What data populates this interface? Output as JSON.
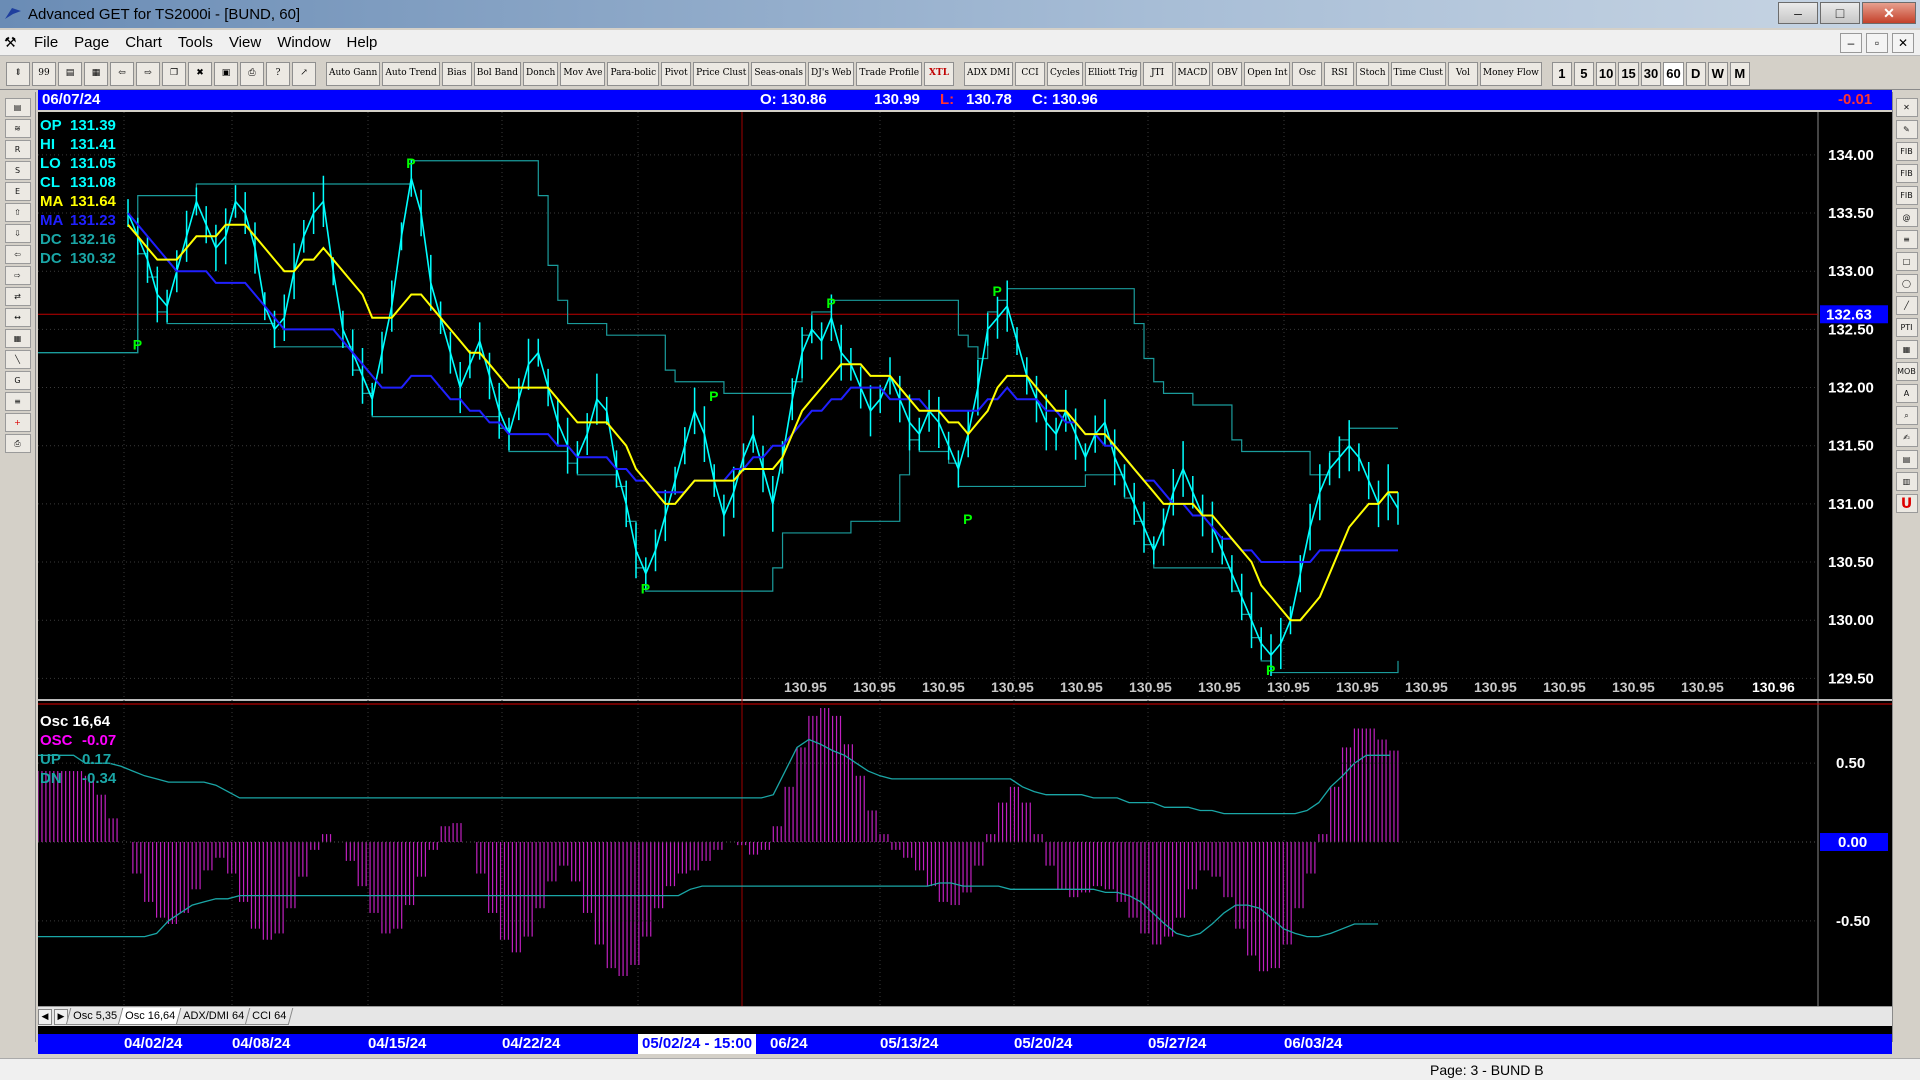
{
  "window": {
    "title": "Advanced GET for TS2000i - [BUND, 60]",
    "minimize": "‒",
    "maximize": "□",
    "close": "✕"
  },
  "menu": [
    "File",
    "Page",
    "Chart",
    "Tools",
    "View",
    "Window",
    "Help"
  ],
  "mdi": {
    "min": "‒",
    "restore": "▫",
    "close": "✕"
  },
  "toolbar": {
    "studies": [
      "Auto Gann",
      "Auto Trend",
      "Bias",
      "Bol Band",
      "Donch",
      "Mov Ave",
      "Para-bolic",
      "Pivot",
      "Price Clust",
      "Seas-onals",
      "DJ's Web",
      "Trade Profile",
      "XTL",
      "ADX DMI",
      "CCI",
      "Cycles",
      "Elliott Trig",
      "JTI",
      "MACD",
      "OBV",
      "Open Int",
      "Osc",
      "RSI",
      "Stoch",
      "Time Clust",
      "Vol",
      "Money Flow"
    ],
    "periods": [
      "1",
      "5",
      "10",
      "15",
      "30",
      "60",
      "D",
      "W",
      "M"
    ],
    "active_period": "60"
  },
  "left_tools": [
    "open",
    "zig",
    "reset",
    "study",
    "elliott",
    "up",
    "down",
    "left",
    "right",
    "expand",
    "zoom",
    "grid",
    "lines",
    "gann",
    "fib",
    "cross",
    "print"
  ],
  "right_tools": [
    "X",
    "pen",
    "fib-ret",
    "fib-ext",
    "fib-time",
    "spiral",
    "fan",
    "box",
    "ellipse",
    "regress",
    "PTI",
    "grid",
    "MOB",
    "A",
    "zoom",
    "paint",
    "layout",
    "table",
    "U"
  ],
  "infobar": {
    "date": "06/07/24",
    "open": "O: 130.86",
    "high": "130.99",
    "low_label": "L:",
    "low": "130.78",
    "close": "C: 130.96",
    "change": "-0.01"
  },
  "price_legend": [
    {
      "label": "OP",
      "value": "131.39",
      "color": "#00ffff"
    },
    {
      "label": "HI",
      "value": "131.41",
      "color": "#00ffff"
    },
    {
      "label": "LO",
      "value": "131.05",
      "color": "#00ffff"
    },
    {
      "label": "CL",
      "value": "131.08",
      "color": "#00ffff"
    },
    {
      "label": "MA",
      "value": "131.64",
      "color": "#ffff00"
    },
    {
      "label": "MA",
      "value": "131.23",
      "color": "#2020ff"
    },
    {
      "label": "DC",
      "value": "132.16",
      "color": "#1aa6a6"
    },
    {
      "label": "DC",
      "value": "130.32",
      "color": "#1aa6a6"
    }
  ],
  "osc_legend": [
    {
      "label": "Osc 16,64",
      "value": "",
      "color": "#ffffff"
    },
    {
      "label": "OSC",
      "value": "-0.07",
      "color": "#ff00ff"
    },
    {
      "label": "UP",
      "value": "0.17",
      "color": "#1aa6a6"
    },
    {
      "label": "DN",
      "value": "-0.34",
      "color": "#1aa6a6"
    }
  ],
  "price_axis": [
    "134.00",
    "133.50",
    "133.00",
    "132.50",
    "132.00",
    "131.50",
    "131.00",
    "130.50",
    "130.00",
    "129.50"
  ],
  "hline_label": "132.63",
  "osc_axis": [
    "0.50",
    "0.00",
    "-0.50"
  ],
  "osc_zero_label": "0.00",
  "bottom_strip": [
    "130.95",
    "130.95",
    "130.95",
    "130.95",
    "130.95",
    "130.95",
    "130.95",
    "130.95",
    "130.95",
    "130.95",
    "130.95",
    "130.95",
    "130.95",
    "130.95"
  ],
  "last_price": "130.96",
  "pivot_label": "P",
  "tabs": [
    "Osc 5,35",
    "Osc 16,64",
    "ADX/DMI 64",
    "CCI 64"
  ],
  "active_tab": "Osc 16,64",
  "dates": [
    "04/02/24",
    "04/08/24",
    "04/15/24",
    "04/22/24",
    "06/24",
    "05/13/24",
    "05/20/24",
    "05/27/24",
    "06/03/24"
  ],
  "cursor_date": "05/02/24 - 15:00",
  "status": "Page: 3 - BUND B",
  "chart_data": {
    "type": "line",
    "symbol": "BUND",
    "interval": "60",
    "ylim": [
      129.4,
      134.3
    ],
    "osc_ylim": [
      -0.85,
      0.85
    ],
    "x_range": [
      0,
      230
    ],
    "horizontal_line": 132.63,
    "vertical_cursor_x": 97,
    "price": [
      133.5,
      133.3,
      133.1,
      132.8,
      132.7,
      133.0,
      133.3,
      133.6,
      133.4,
      133.2,
      133.3,
      133.6,
      133.5,
      133.2,
      132.7,
      132.5,
      132.6,
      133.0,
      133.3,
      133.5,
      133.6,
      133.0,
      132.5,
      132.3,
      132.1,
      131.9,
      132.3,
      132.7,
      133.3,
      133.8,
      133.5,
      132.9,
      132.6,
      132.3,
      132.0,
      132.2,
      132.4,
      132.1,
      131.8,
      131.6,
      131.9,
      132.2,
      132.3,
      132.0,
      131.7,
      131.5,
      131.4,
      131.6,
      131.9,
      131.8,
      131.3,
      131.0,
      130.6,
      130.4,
      130.6,
      130.9,
      131.2,
      131.5,
      131.8,
      131.6,
      131.2,
      130.9,
      131.1,
      131.4,
      131.6,
      131.3,
      131.0,
      131.4,
      131.9,
      132.3,
      132.5,
      132.4,
      132.6,
      132.3,
      132.2,
      132.0,
      131.8,
      131.9,
      132.1,
      131.9,
      131.7,
      131.6,
      131.8,
      131.7,
      131.5,
      131.3,
      131.6,
      132.0,
      132.5,
      132.6,
      132.7,
      132.4,
      132.1,
      131.9,
      131.7,
      131.6,
      131.8,
      131.6,
      131.4,
      131.6,
      131.7,
      131.4,
      131.2,
      131.0,
      130.8,
      130.6,
      130.8,
      131.1,
      131.3,
      131.1,
      130.9,
      130.8,
      130.6,
      130.4,
      130.2,
      130.0,
      129.8,
      129.7,
      129.8,
      130.0,
      130.4,
      130.8,
      131.1,
      131.3,
      131.4,
      131.5,
      131.4,
      131.2,
      131.0,
      131.1,
      130.96
    ],
    "ma_fast": [
      133.4,
      133.3,
      133.2,
      133.1,
      133.1,
      133.1,
      133.2,
      133.3,
      133.3,
      133.3,
      133.4,
      133.4,
      133.4,
      133.3,
      133.2,
      133.1,
      133.0,
      133.0,
      133.1,
      133.1,
      133.2,
      133.1,
      133.0,
      132.9,
      132.8,
      132.6,
      132.6,
      132.6,
      132.7,
      132.8,
      132.8,
      132.7,
      132.6,
      132.5,
      132.4,
      132.3,
      132.3,
      132.2,
      132.1,
      132.0,
      132.0,
      132.0,
      132.0,
      132.0,
      131.9,
      131.8,
      131.7,
      131.7,
      131.7,
      131.7,
      131.6,
      131.5,
      131.3,
      131.2,
      131.1,
      131.0,
      131.0,
      131.1,
      131.2,
      131.2,
      131.2,
      131.2,
      131.2,
      131.3,
      131.3,
      131.3,
      131.3,
      131.4,
      131.6,
      131.8,
      131.9,
      132.0,
      132.1,
      132.2,
      132.2,
      132.2,
      132.1,
      132.1,
      132.1,
      132.0,
      131.9,
      131.8,
      131.8,
      131.8,
      131.7,
      131.7,
      131.6,
      131.7,
      131.8,
      132.0,
      132.1,
      132.1,
      132.1,
      132.0,
      131.9,
      131.8,
      131.8,
      131.7,
      131.6,
      131.6,
      131.6,
      131.5,
      131.4,
      131.3,
      131.2,
      131.1,
      131.0,
      131.0,
      131.0,
      131.0,
      130.9,
      130.9,
      130.8,
      130.7,
      130.6,
      130.5,
      130.3,
      130.2,
      130.1,
      130.0,
      130.0,
      130.1,
      130.2,
      130.4,
      130.6,
      130.8,
      130.9,
      131.0,
      131.0,
      131.1,
      131.1
    ],
    "ma_slow": [
      133.5,
      133.4,
      133.3,
      133.2,
      133.1,
      133.0,
      133.0,
      133.0,
      133.0,
      132.9,
      132.9,
      132.9,
      132.9,
      132.8,
      132.7,
      132.6,
      132.5,
      132.5,
      132.5,
      132.5,
      132.5,
      132.5,
      132.4,
      132.3,
      132.2,
      132.1,
      132.0,
      132.0,
      132.0,
      132.1,
      132.1,
      132.1,
      132.0,
      131.9,
      131.9,
      131.8,
      131.8,
      131.7,
      131.7,
      131.6,
      131.6,
      131.6,
      131.6,
      131.6,
      131.5,
      131.5,
      131.4,
      131.4,
      131.4,
      131.4,
      131.3,
      131.3,
      131.2,
      131.2,
      131.1,
      131.1,
      131.1,
      131.1,
      131.2,
      131.2,
      131.2,
      131.2,
      131.3,
      131.3,
      131.4,
      131.4,
      131.5,
      131.5,
      131.6,
      131.7,
      131.8,
      131.8,
      131.9,
      131.9,
      132.0,
      132.0,
      132.0,
      132.0,
      131.9,
      131.9,
      131.9,
      131.9,
      131.8,
      131.8,
      131.8,
      131.8,
      131.8,
      131.8,
      131.9,
      131.9,
      132.0,
      131.9,
      131.9,
      131.9,
      131.8,
      131.8,
      131.7,
      131.7,
      131.6,
      131.6,
      131.5,
      131.5,
      131.4,
      131.3,
      131.2,
      131.2,
      131.1,
      131.0,
      131.0,
      130.9,
      130.9,
      130.8,
      130.7,
      130.7,
      130.6,
      130.6,
      130.5,
      130.5,
      130.5,
      130.5,
      130.5,
      130.5,
      130.6,
      130.6,
      130.6,
      130.6,
      130.6,
      130.6,
      130.6,
      130.6,
      130.6
    ],
    "pivots": [
      {
        "x": 1,
        "y": 132.5,
        "pos": "low"
      },
      {
        "x": 29,
        "y": 133.8,
        "pos": "high"
      },
      {
        "x": 53,
        "y": 130.4,
        "pos": "low"
      },
      {
        "x": 60,
        "y": 131.8,
        "pos": "high"
      },
      {
        "x": 72,
        "y": 132.6,
        "pos": "high"
      },
      {
        "x": 86,
        "y": 131.0,
        "pos": "low"
      },
      {
        "x": 89,
        "y": 132.7,
        "pos": "high"
      },
      {
        "x": 117,
        "y": 129.7,
        "pos": "low"
      }
    ],
    "oscillator": [
      0.45,
      0.45,
      0.45,
      0.45,
      0.42,
      0.3,
      0.15,
      0.0,
      -0.2,
      -0.38,
      -0.48,
      -0.52,
      -0.45,
      -0.3,
      -0.18,
      -0.1,
      -0.2,
      -0.38,
      -0.55,
      -0.62,
      -0.58,
      -0.42,
      -0.22,
      -0.05,
      0.05,
      0.0,
      -0.12,
      -0.28,
      -0.45,
      -0.58,
      -0.55,
      -0.4,
      -0.22,
      -0.05,
      0.1,
      0.12,
      0.0,
      -0.2,
      -0.45,
      -0.62,
      -0.7,
      -0.6,
      -0.42,
      -0.25,
      -0.15,
      -0.25,
      -0.45,
      -0.65,
      -0.8,
      -0.85,
      -0.78,
      -0.6,
      -0.42,
      -0.28,
      -0.2,
      -0.18,
      -0.12,
      -0.05,
      0.0,
      -0.02,
      -0.08,
      -0.05,
      0.1,
      0.35,
      0.6,
      0.8,
      0.85,
      0.8,
      0.62,
      0.42,
      0.2,
      0.05,
      -0.05,
      -0.1,
      -0.18,
      -0.28,
      -0.38,
      -0.4,
      -0.32,
      -0.15,
      0.05,
      0.25,
      0.35,
      0.25,
      0.05,
      -0.15,
      -0.3,
      -0.35,
      -0.32,
      -0.28,
      -0.3,
      -0.38,
      -0.48,
      -0.58,
      -0.65,
      -0.6,
      -0.48,
      -0.3,
      -0.18,
      -0.22,
      -0.35,
      -0.55,
      -0.72,
      -0.82,
      -0.8,
      -0.65,
      -0.42,
      -0.2,
      0.05,
      0.35,
      0.6,
      0.72,
      0.72,
      0.65,
      0.58
    ],
    "osc_up": [
      0.55,
      0.55,
      0.55,
      0.55,
      0.5,
      0.5,
      0.5,
      0.48,
      0.45,
      0.42,
      0.4,
      0.38,
      0.38,
      0.38,
      0.38,
      0.36,
      0.32,
      0.28,
      0.28,
      0.28,
      0.28,
      0.28,
      0.28,
      0.28,
      0.28,
      0.28,
      0.28,
      0.28,
      0.28,
      0.28,
      0.28,
      0.28,
      0.28,
      0.28,
      0.28,
      0.28,
      0.28,
      0.28,
      0.28,
      0.28,
      0.28,
      0.28,
      0.28,
      0.28,
      0.28,
      0.28,
      0.28,
      0.28,
      0.28,
      0.28,
      0.28,
      0.28,
      0.28,
      0.28,
      0.28,
      0.28,
      0.28,
      0.28,
      0.28,
      0.28,
      0.28,
      0.28,
      0.3,
      0.45,
      0.6,
      0.65,
      0.62,
      0.58,
      0.55,
      0.5,
      0.45,
      0.42,
      0.4,
      0.4,
      0.4,
      0.4,
      0.4,
      0.4,
      0.4,
      0.4,
      0.4,
      0.4,
      0.4,
      0.35,
      0.32,
      0.3,
      0.3,
      0.3,
      0.3,
      0.28,
      0.28,
      0.28,
      0.25,
      0.25,
      0.25,
      0.22,
      0.22,
      0.22,
      0.2,
      0.2,
      0.18,
      0.18,
      0.18,
      0.18,
      0.18,
      0.18,
      0.18,
      0.2,
      0.25,
      0.35,
      0.42,
      0.5,
      0.55,
      0.55,
      0.55
    ],
    "osc_dn": [
      -0.6,
      -0.6,
      -0.6,
      -0.6,
      -0.6,
      -0.6,
      -0.6,
      -0.6,
      -0.6,
      -0.6,
      -0.58,
      -0.5,
      -0.45,
      -0.4,
      -0.38,
      -0.36,
      -0.36,
      -0.34,
      -0.34,
      -0.34,
      -0.34,
      -0.34,
      -0.34,
      -0.34,
      -0.34,
      -0.34,
      -0.34,
      -0.34,
      -0.34,
      -0.34,
      -0.34,
      -0.34,
      -0.34,
      -0.34,
      -0.34,
      -0.34,
      -0.34,
      -0.34,
      -0.34,
      -0.34,
      -0.34,
      -0.34,
      -0.34,
      -0.34,
      -0.34,
      -0.34,
      -0.34,
      -0.34,
      -0.34,
      -0.34,
      -0.34,
      -0.34,
      -0.34,
      -0.34,
      -0.34,
      -0.3,
      -0.28,
      -0.28,
      -0.28,
      -0.28,
      -0.28,
      -0.28,
      -0.28,
      -0.28,
      -0.28,
      -0.28,
      -0.28,
      -0.28,
      -0.28,
      -0.28,
      -0.28,
      -0.28,
      -0.28,
      -0.28,
      -0.28,
      -0.28,
      -0.26,
      -0.26,
      -0.28,
      -0.28,
      -0.28,
      -0.28,
      -0.3,
      -0.3,
      -0.3,
      -0.3,
      -0.3,
      -0.3,
      -0.3,
      -0.3,
      -0.32,
      -0.32,
      -0.34,
      -0.38,
      -0.45,
      -0.52,
      -0.58,
      -0.6,
      -0.58,
      -0.52,
      -0.45,
      -0.4,
      -0.4,
      -0.42,
      -0.48,
      -0.55,
      -0.58,
      -0.6,
      -0.6,
      -0.58,
      -0.55,
      -0.52,
      -0.52,
      -0.52
    ]
  }
}
